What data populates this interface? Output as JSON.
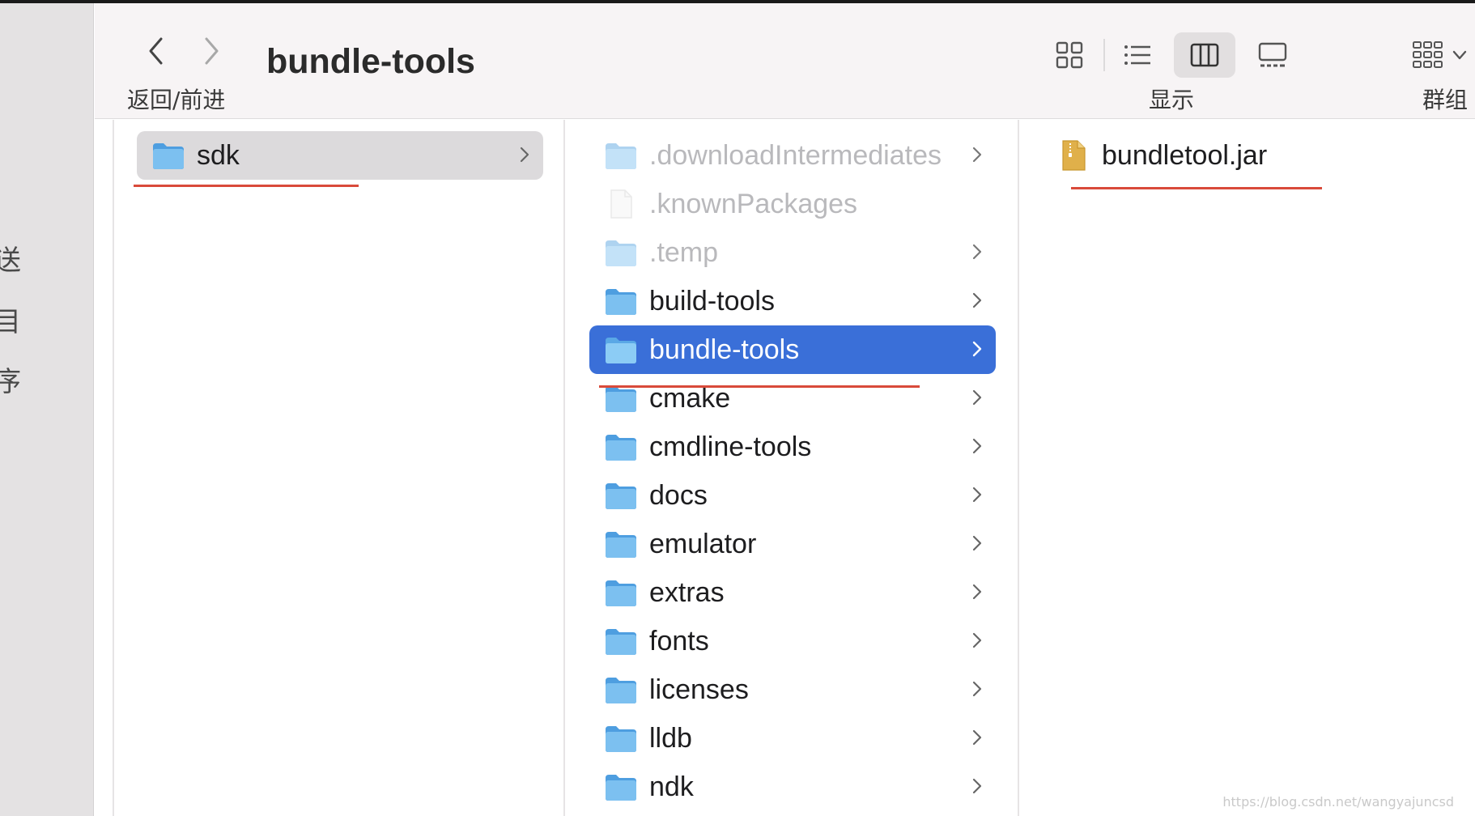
{
  "window": {
    "title": "bundle-tools"
  },
  "toolbar": {
    "nav_caption": "返回/前进",
    "view_caption": "显示",
    "group_caption": "群组",
    "active_view": "column-view"
  },
  "sidebar": {
    "fragments": [
      "送",
      "目",
      "序"
    ]
  },
  "columns": {
    "col1": {
      "items": [
        {
          "name": "sdk",
          "type": "folder",
          "selected": true
        }
      ]
    },
    "col2": {
      "items": [
        {
          "name": ".downloadIntermediates",
          "type": "folder",
          "hidden": true
        },
        {
          "name": ".knownPackages",
          "type": "file",
          "hidden": true
        },
        {
          "name": ".temp",
          "type": "folder",
          "hidden": true
        },
        {
          "name": "build-tools",
          "type": "folder"
        },
        {
          "name": "bundle-tools",
          "type": "folder",
          "selected": true
        },
        {
          "name": "cmake",
          "type": "folder"
        },
        {
          "name": "cmdline-tools",
          "type": "folder"
        },
        {
          "name": "docs",
          "type": "folder"
        },
        {
          "name": "emulator",
          "type": "folder"
        },
        {
          "name": "extras",
          "type": "folder"
        },
        {
          "name": "fonts",
          "type": "folder"
        },
        {
          "name": "licenses",
          "type": "folder"
        },
        {
          "name": "lldb",
          "type": "folder"
        },
        {
          "name": "ndk",
          "type": "folder"
        }
      ]
    },
    "col3": {
      "items": [
        {
          "name": "bundletool.jar",
          "type": "jar"
        }
      ]
    }
  },
  "colors": {
    "selection_blue": "#3a6fd8",
    "annotation_red": "#d94a3a",
    "folder_blue": "#6fb6ea"
  },
  "watermark": "https://blog.csdn.net/wangyajuncsd"
}
